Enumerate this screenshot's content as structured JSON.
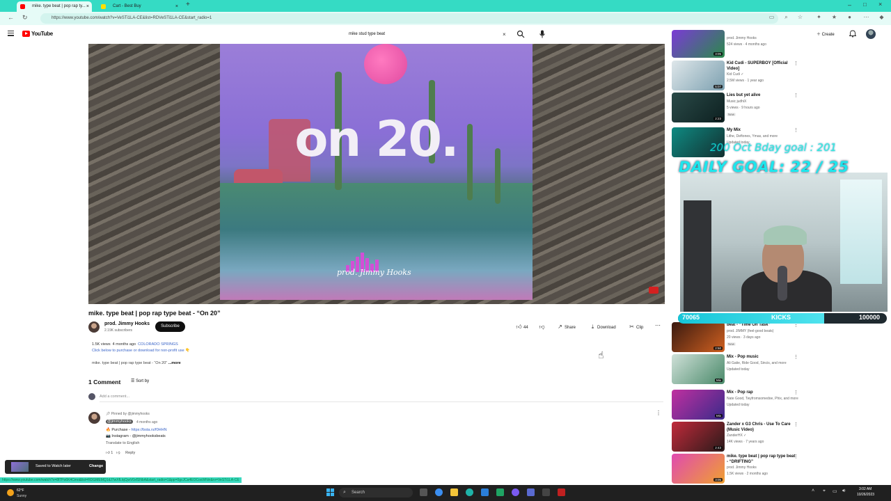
{
  "browser": {
    "tabs": [
      {
        "title": "mike. type beat | pop rap ty...",
        "active": true,
        "favicon_color": "#ff0000"
      },
      {
        "title": "Cart - Best Buy",
        "active": false,
        "favicon_color": "#ffe000"
      }
    ],
    "new_tab": "+",
    "url": "https://www.youtube.com/watch?v=VeSTi1LA-CE&list=RDVeSTi1LA-CE&start_radio=1"
  },
  "youtube": {
    "logo_text": "YouTube",
    "search_value": "mike stud type beat",
    "create_label": "Create"
  },
  "video": {
    "thumbnail_text": "on 20.",
    "thumbnail_signature": "prod. Jimmy Hooks",
    "title": "mike. type beat | pop rap type beat - “On 20”",
    "channel_name": "prod. Jimmy Hooks",
    "channel_subs": "2.19K subscribers",
    "subscribe_label": "Subscribe",
    "likes": "44",
    "share_label": "Share",
    "download_label": "Download",
    "clip_label": "Clip",
    "views": "1.5K views",
    "age": "4 months ago",
    "location": "COLORADO SPRINGS",
    "desc_line2": "Click below to purchase or download for non-profit use 👇",
    "desc_line3": "mike. type beat | pop rap type beat - “On 20”",
    "desc_more": "...more"
  },
  "comments": {
    "count_label": "1 Comment",
    "sort_label": "Sort by",
    "add_placeholder": "Add a comment...",
    "pinned_label": "Pinned by @jimmyhooks",
    "author": "@jimmyhooks",
    "time": "4 months ago",
    "line1_prefix": "🔥 Purchase - ",
    "line1_link": "https://bsta.rs/f0HHN",
    "line2": "📷 Instagram - @jimmyhooksbeats",
    "translate": "Translate to English",
    "likes": "1",
    "reply_label": "Reply"
  },
  "toast": {
    "text": "Saved to Watch later",
    "action": "Change"
  },
  "status_url": "https://www.youtube.com/watch?v=8f7Po6K4Cmo&list=RDGMEMQ1dJ7wXfLlqCjwV0xfSNbA&start_radio=1&pp=0gcJCa4EOCosWNin&rv=VeSTi1LA-CE",
  "recommendations": [
    {
      "title": "",
      "sub1": "prod. Jimmy Hooks",
      "sub2": "524 views · 4 months ago",
      "duration": "3:05",
      "badge": "",
      "colors": [
        "#7b3ad6",
        "#2a8a4a"
      ]
    },
    {
      "title": "Kid Cudi - SUPERBOY [Official Video]",
      "sub1": "Kid Cudi ✓",
      "sub2": "2.5M views · 1 year ago",
      "duration": "5:07",
      "badge": "",
      "colors": [
        "#dfe7ea",
        "#7ca0b0"
      ]
    },
    {
      "title": "Lies but yet alive",
      "sub1": "Music judhiX",
      "sub2": "5 views · 9 hours ago",
      "duration": "2:23",
      "badge": "New",
      "colors": [
        "#2a4a48",
        "#0d2020"
      ]
    },
    {
      "title": "My Mix",
      "sub1": "Lithe, Deftones, Ymas, and more",
      "sub2": "Updated today",
      "duration": "",
      "badge": "",
      "colors": [
        "#0e8a82",
        "#133030"
      ]
    },
    {
      "title": "beat - “Time On Task”",
      "sub1": "prod. JIMMY (feel-good beats)",
      "sub2": "20 views · 3 days ago",
      "duration": "2:50",
      "badge": "New",
      "colors": [
        "#3a1a10",
        "#d06020"
      ]
    },
    {
      "title": "Mix - Pop music",
      "sub1": "Ali Gatie, Ride Good, Sincis, and more",
      "sub2": "Updated today",
      "duration": "Mix",
      "badge": "",
      "colors": [
        "#cfe0d8",
        "#4a8a6a"
      ]
    },
    {
      "title": "Mix - Pop rap",
      "sub1": "Nate Good, Twyfromsomedoe, Phix, and more",
      "sub2": "Updated today",
      "duration": "Mix",
      "badge": "",
      "colors": [
        "#c030a0",
        "#3a2a8a"
      ]
    },
    {
      "title": "Zander x G3 Chris - Use To Care (Music Video)",
      "sub1": "ZanderHX ✓",
      "sub2": "14K views · 7 years ago",
      "duration": "2:43",
      "badge": "",
      "colors": [
        "#c02a3a",
        "#2a1a1a"
      ]
    },
    {
      "title": "mike. type beat | pop rap type beat - “DRIFTING”",
      "sub1": "prod. Jimmy Hooks",
      "sub2": "1.5K views · 2 months ago",
      "duration": "3:05",
      "badge": "",
      "colors": [
        "#e04ab0",
        "#f0a030"
      ]
    }
  ],
  "overlay": {
    "follow_goal": "200 Oct Bday goal : 201",
    "daily_goal": "DAILY GOAL: 22 / 25",
    "kicks_start": "70065",
    "kicks_label": "KICKS",
    "kicks_end": "100000",
    "kicks_progress": 0.7
  },
  "taskbar": {
    "temp": "62°F",
    "condition": "Sunny",
    "search_placeholder": "Search",
    "time": "3:02 AM",
    "date": "10/26/2023"
  }
}
